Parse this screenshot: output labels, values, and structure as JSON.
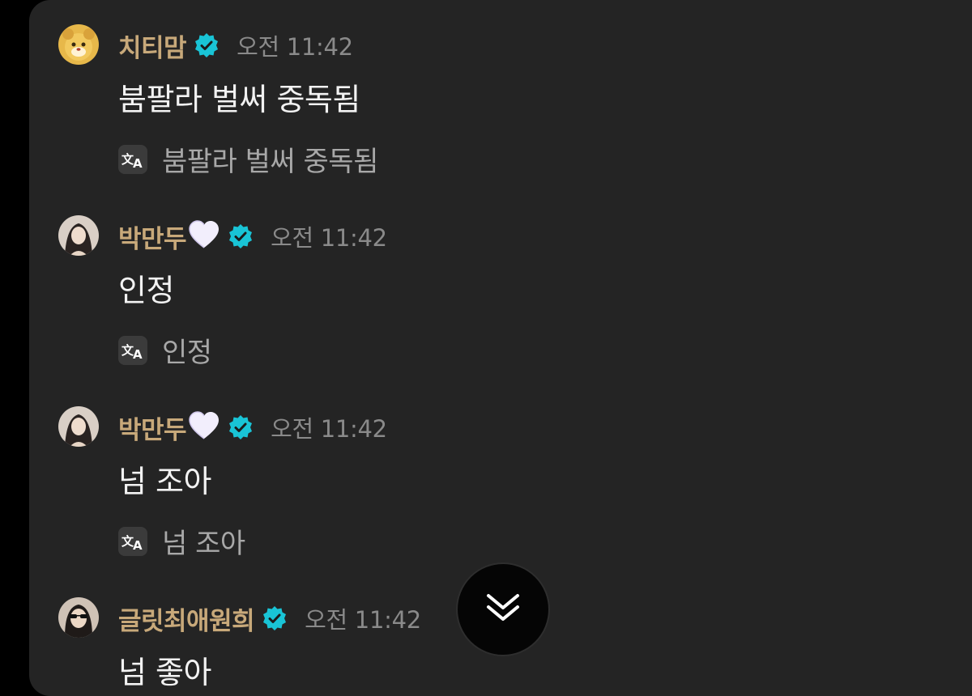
{
  "colors": {
    "background": "#242424",
    "nickname": "#c8a97a",
    "verified_badge": "#19c4d6",
    "time": "#8a8a8a",
    "message_text": "#f2f2f2",
    "translation_text": "#a8a8a8"
  },
  "messages": [
    {
      "nickname": "치티맘",
      "avatar_icon": "tiger-character-avatar",
      "heart": false,
      "time": "오전 11:42",
      "text": "붐팔라 벌써 중독됨",
      "translation": "붐팔라 벌써 중독됨"
    },
    {
      "nickname": "박만두",
      "avatar_icon": "profile-photo-avatar",
      "heart": true,
      "time": "오전 11:42",
      "text": "인정",
      "translation": "인정"
    },
    {
      "nickname": "박만두",
      "avatar_icon": "profile-photo-avatar",
      "heart": true,
      "time": "오전 11:42",
      "text": "넘 조아",
      "translation": "넘 조아"
    },
    {
      "nickname": "글릿최애원희",
      "avatar_icon": "sunglasses-photo-avatar",
      "heart": false,
      "time": "오전 11:42",
      "text": "넘 좋아",
      "translation": ""
    }
  ],
  "icons": {
    "verified": "verified-badge-icon",
    "translate": "translate-icon",
    "heart": "white-heart-icon",
    "scroll_down": "double-chevron-down-icon"
  }
}
